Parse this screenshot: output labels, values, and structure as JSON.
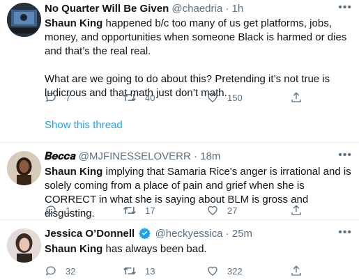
{
  "tweets": [
    {
      "name": "No Quarter Will Be Given",
      "handle": "@chaedria",
      "separator": "·",
      "time": "1h",
      "body_lines": [
        {
          "mention": "Shaun King",
          "text": " happened b/c too many of us get platforms, jobs, money, and opportunities when someone Black is harmed or dies and that’s the real real."
        },
        {
          "mention": "",
          "text": "What are we going to do about this? Pretending it’s not true is ludicrous and that math just don’t math."
        }
      ],
      "replies": "7",
      "retweets": "40",
      "likes": "150",
      "show_thread": "Show this thread"
    },
    {
      "name": "𝑩𝒆𝒄𝒄𝒂",
      "handle": "@MJFINESSELOVERR",
      "separator": "·",
      "time": "18m",
      "body_lines": [
        {
          "mention": "Shaun King",
          "text": " implying that Samaria Rice's anger is irrational and is solely coming from a place of pain and grief when she is CORRECT in what she is saying about BLM is gross and disgusting."
        }
      ],
      "replies": "1",
      "retweets": "17",
      "likes": "27"
    },
    {
      "name": "Jessica O’Donnell",
      "handle": "@heckyessica",
      "separator": "·",
      "time": "25m",
      "body_lines": [
        {
          "mention": "Shaun King",
          "text": " has always been bad."
        }
      ],
      "replies": "32",
      "retweets": "13",
      "likes": "322"
    }
  ],
  "icons": {
    "more": "more-icon",
    "reply": "reply-icon",
    "retweet": "retweet-icon",
    "like": "heart-icon",
    "share": "share-icon",
    "verified": "verified-badge-icon"
  },
  "colors": {
    "text": "#0f1419",
    "secondary": "#5b7083",
    "link": "#1da1f2",
    "divider": "#e6ecf0"
  }
}
